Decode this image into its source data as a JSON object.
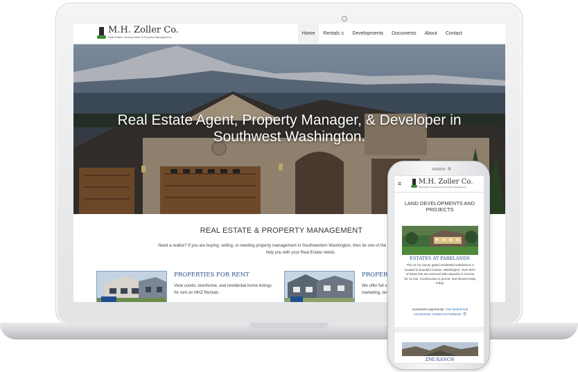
{
  "laptop": {
    "site": {
      "logo": {
        "name": "M.H. Zoller Co.",
        "tagline": "Real Estate, Development & Property Management"
      },
      "nav": [
        {
          "label": "Home",
          "active": true
        },
        {
          "label": "Rentals",
          "external": true
        },
        {
          "label": "Developments"
        },
        {
          "label": "Documents"
        },
        {
          "label": "About"
        },
        {
          "label": "Contact"
        }
      ],
      "hero": {
        "title": "Real Estate Agent, Property Manager, & Developer in Southwest Washington."
      },
      "section": {
        "title": "REAL ESTATE & PROPERTY MANAGEMENT",
        "intro": "Need a realtor? If you are buying, selling, or needing property management in Southwestern Washington, then let one of the Realtors at the M.H. Zoller Co. help you with your Real Estate needs."
      },
      "cards": [
        {
          "title": "PROPERTIES FOR RENT",
          "text": "View condo, townhome, and residential home listings for rent on MHZ Rentals."
        },
        {
          "title": "PROPERTY MANAGEMENT",
          "text": "We offer full service property management including marketing, tenant screening, paperwork, and more."
        }
      ]
    }
  },
  "phone": {
    "logo": {
      "name": "M.H. Zoller Co.",
      "tagline": "Real Estate, Development & Property Management"
    },
    "menu_icon": "≡",
    "heading": "LAND DEVELOPMENTS AND PROJECTS",
    "cards": [
      {
        "title": "ESTATES AT PARKLANDS",
        "text": "This 41 lot, luxury gated residential subdivision is located in beautiful Camas, Washington. Over 50% of these lots are reserved with deposits in escrow for 21 lots. Construction is permit- and shovel-ready today.",
        "investment_label": "Investment opportunity:",
        "investment_link": "Visit Mark4Fund Investments: Estates at Parklands"
      },
      {
        "title": "ZMI RANCH"
      }
    ]
  },
  "colors": {
    "accent_blue": "#2a4f8a",
    "link_blue": "#2f6fb5",
    "logo_green": "#3f8f3a"
  },
  "icons": [
    "camera-icon",
    "external-link-icon",
    "hamburger-menu-icon",
    "phone-speaker-icon"
  ]
}
